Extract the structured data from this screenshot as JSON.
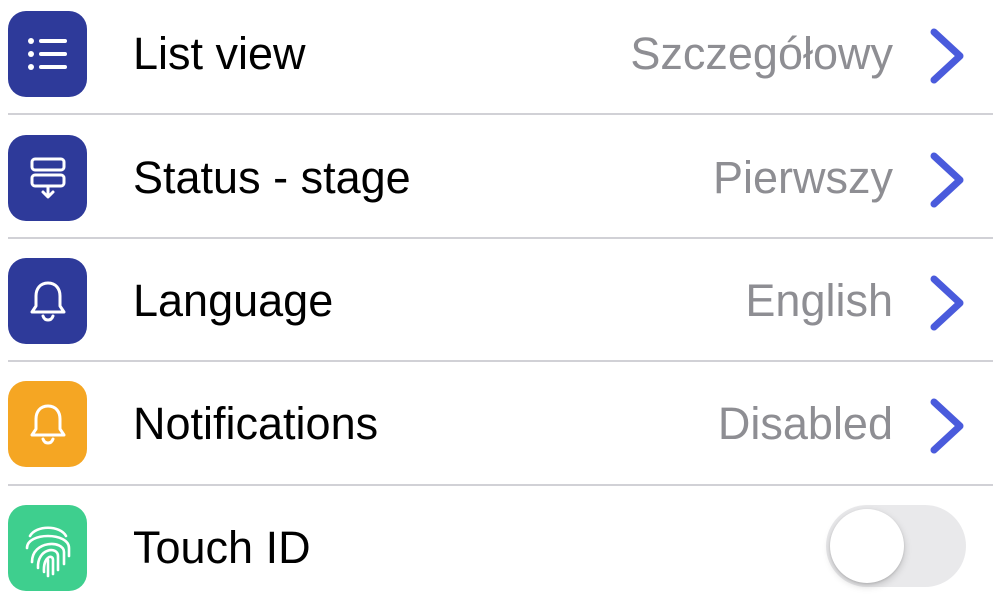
{
  "settings": {
    "items": [
      {
        "label": "List view",
        "value": "Szczegółowy",
        "icon": "list-icon",
        "icon_color": "#2e3a9a"
      },
      {
        "label": "Status - stage",
        "value": "Pierwszy",
        "icon": "status-stage-icon",
        "icon_color": "#2e3a9a"
      },
      {
        "label": "Language",
        "value": "English",
        "icon": "bell-icon",
        "icon_color": "#2e3a9a"
      },
      {
        "label": "Notifications",
        "value": "Disabled",
        "icon": "bell-icon",
        "icon_color": "#f5a623"
      },
      {
        "label": "Touch ID",
        "toggle_on": false,
        "icon": "fingerprint-icon",
        "icon_color": "#3ecf8e"
      }
    ]
  },
  "colors": {
    "chevron": "#4a5bdc",
    "value_text": "#8e8e93",
    "divider": "#d1d1d6",
    "toggle_off_track": "#e9e9eb"
  }
}
